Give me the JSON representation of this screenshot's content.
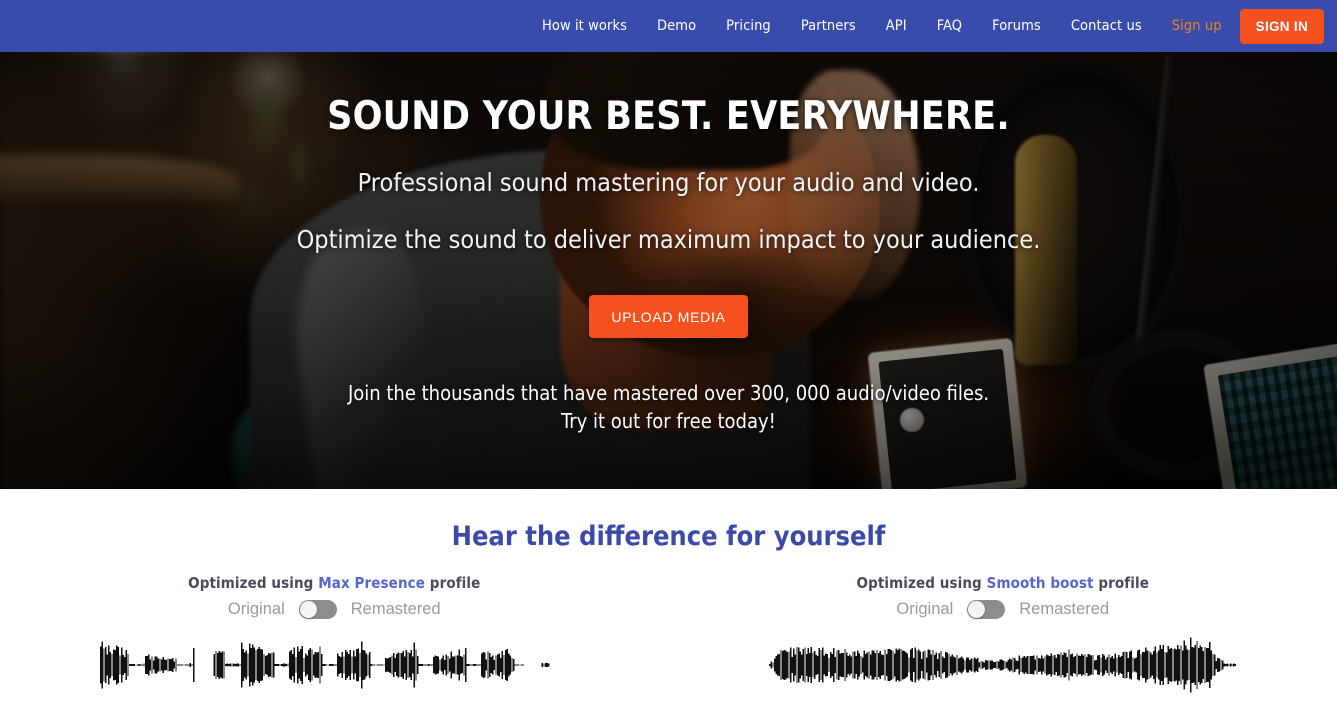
{
  "header": {
    "nav_items": [
      {
        "label": "How it works",
        "name": "nav-how-it-works"
      },
      {
        "label": "Demo",
        "name": "nav-demo"
      },
      {
        "label": "Pricing",
        "name": "nav-pricing"
      },
      {
        "label": "Partners",
        "name": "nav-partners"
      },
      {
        "label": "API",
        "name": "nav-api"
      },
      {
        "label": "FAQ",
        "name": "nav-faq"
      },
      {
        "label": "Forums",
        "name": "nav-forums"
      },
      {
        "label": "Contact us",
        "name": "nav-contact-us"
      }
    ],
    "signup_label": "Sign up",
    "signin_label": "SIGN IN",
    "bg_color": "#3a4cab",
    "signup_color": "#e8871e",
    "signin_color": "#f4511e"
  },
  "hero": {
    "title": "SOUND YOUR BEST. EVERYWHERE.",
    "subtitle_1": "Professional sound mastering for your audio and video.",
    "subtitle_2": "Optimize the sound to deliver maximum impact to your audience.",
    "cta_label": "UPLOAD MEDIA",
    "join_line_1": "Join the thousands that have mastered over 300, 000 audio/video files.",
    "join_line_2": "Try it out for free today!"
  },
  "compare": {
    "title": "Hear the difference for yourself",
    "title_color": "#3b4aa8",
    "columns": [
      {
        "prefix": "Optimized using ",
        "profile": "Max Presence",
        "suffix": " profile",
        "toggle_left_label": "Original",
        "toggle_right_label": "Remastered",
        "toggle_state": "Original"
      },
      {
        "prefix": "Optimized using ",
        "profile": "Smooth boost",
        "suffix": " profile",
        "toggle_left_label": "Original",
        "toggle_right_label": "Remastered",
        "toggle_state": "Original"
      }
    ]
  }
}
